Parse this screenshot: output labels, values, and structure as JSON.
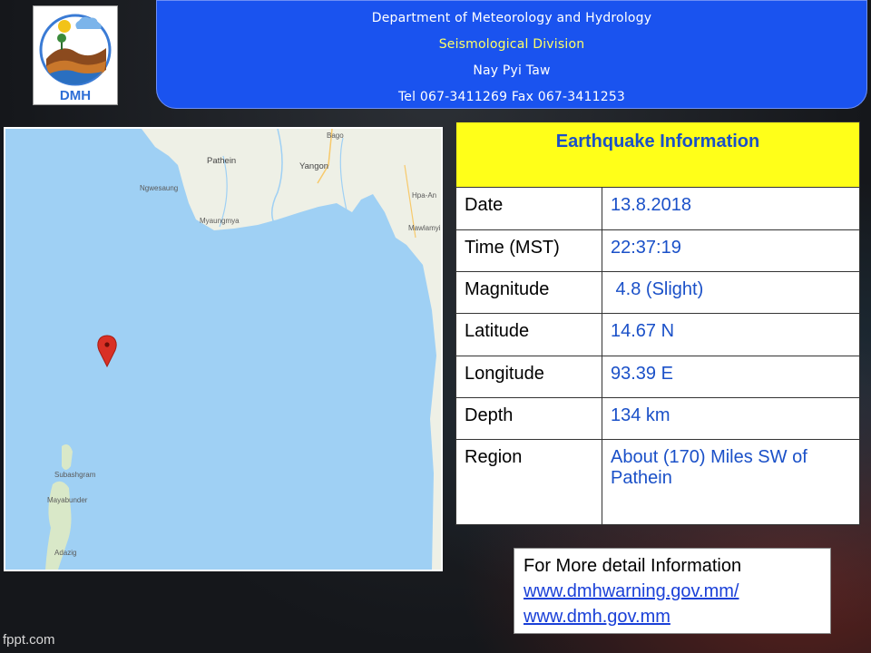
{
  "header": {
    "department": "Department of Meteorology and Hydrology",
    "division": "Seismological Division",
    "city": "Nay Pyi Taw",
    "contact": "Tel 067-3411269 Fax 067-3411253"
  },
  "logo": {
    "text": "DMH"
  },
  "map": {
    "labels": {
      "bago": "Bago",
      "pathein": "Pathein",
      "yangon": "Yangon",
      "ngwesaung": "Ngwesaung",
      "myaungmya": "Myaungmya",
      "hpa_an": "Hpa-An",
      "mawlamyine": "Mawlamyin",
      "subashgram": "Subashgram",
      "mayabunder": "Mayabunder",
      "adazig": "Adazig"
    },
    "marker_icon": "map-pin-icon",
    "colors": {
      "sea": "#9fd0f4",
      "land": "#eef0e6",
      "marker": "#d93025"
    }
  },
  "info": {
    "title": "Earthquake Information",
    "rows": [
      {
        "label": "Date",
        "value": "13.8.2018"
      },
      {
        "label": "Time (MST)",
        "value": "22:37:19"
      },
      {
        "label": "Magnitude",
        "value": " 4.8 (Slight)"
      },
      {
        "label": "Latitude",
        "value": "14.67 N"
      },
      {
        "label": "Longitude",
        "value": "93.39 E"
      },
      {
        "label": "Depth",
        "value": "134 km"
      },
      {
        "label": "Region",
        "value": "About (170) Miles SW of Pathein"
      }
    ]
  },
  "detail": {
    "heading": "For More detail Information",
    "link1": "www.dmhwarning.gov.mm/",
    "link2": "www.dmh.gov.mm"
  },
  "watermark": "fppt.com",
  "colors": {
    "banner": "#1a53ef",
    "title_bg": "#ffff19",
    "value_text": "#1a50c8"
  }
}
